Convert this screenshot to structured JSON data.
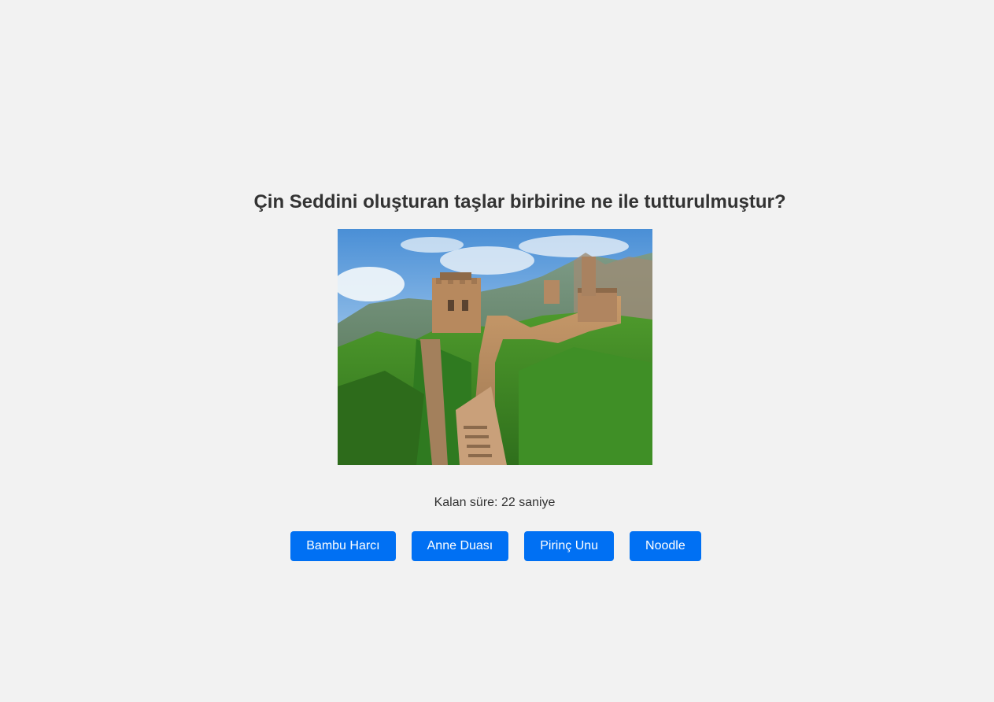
{
  "quiz": {
    "question": "Çin Seddini oluşturan taşlar birbirine ne ile tutturulmuştur?",
    "timer_text": "Kalan süre: 22 saniye",
    "options": [
      {
        "label": "Bambu Harcı"
      },
      {
        "label": "Anne Duası"
      },
      {
        "label": "Pirinç Unu"
      },
      {
        "label": "Noodle"
      }
    ]
  },
  "colors": {
    "background": "#f2f2f2",
    "button": "#0070f3",
    "text": "#333333"
  }
}
